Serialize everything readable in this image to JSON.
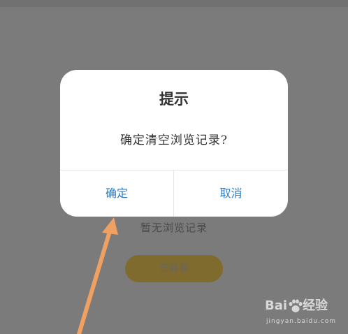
{
  "background_page": {
    "empty_message": "暂无浏览记录",
    "browse_button_label": "去看看"
  },
  "dialog": {
    "title": "提示",
    "message": "确定清空浏览记录?",
    "confirm_label": "确定",
    "cancel_label": "取消"
  },
  "watermark": {
    "brand_left": "Bai",
    "brand_right": "经验",
    "url": "jingyan.baidu.com"
  },
  "colors": {
    "overlay": "#7b7b7b",
    "dialog_bg": "#ffffff",
    "button_text": "#2f7dc4",
    "arrow": "#f0a060"
  }
}
